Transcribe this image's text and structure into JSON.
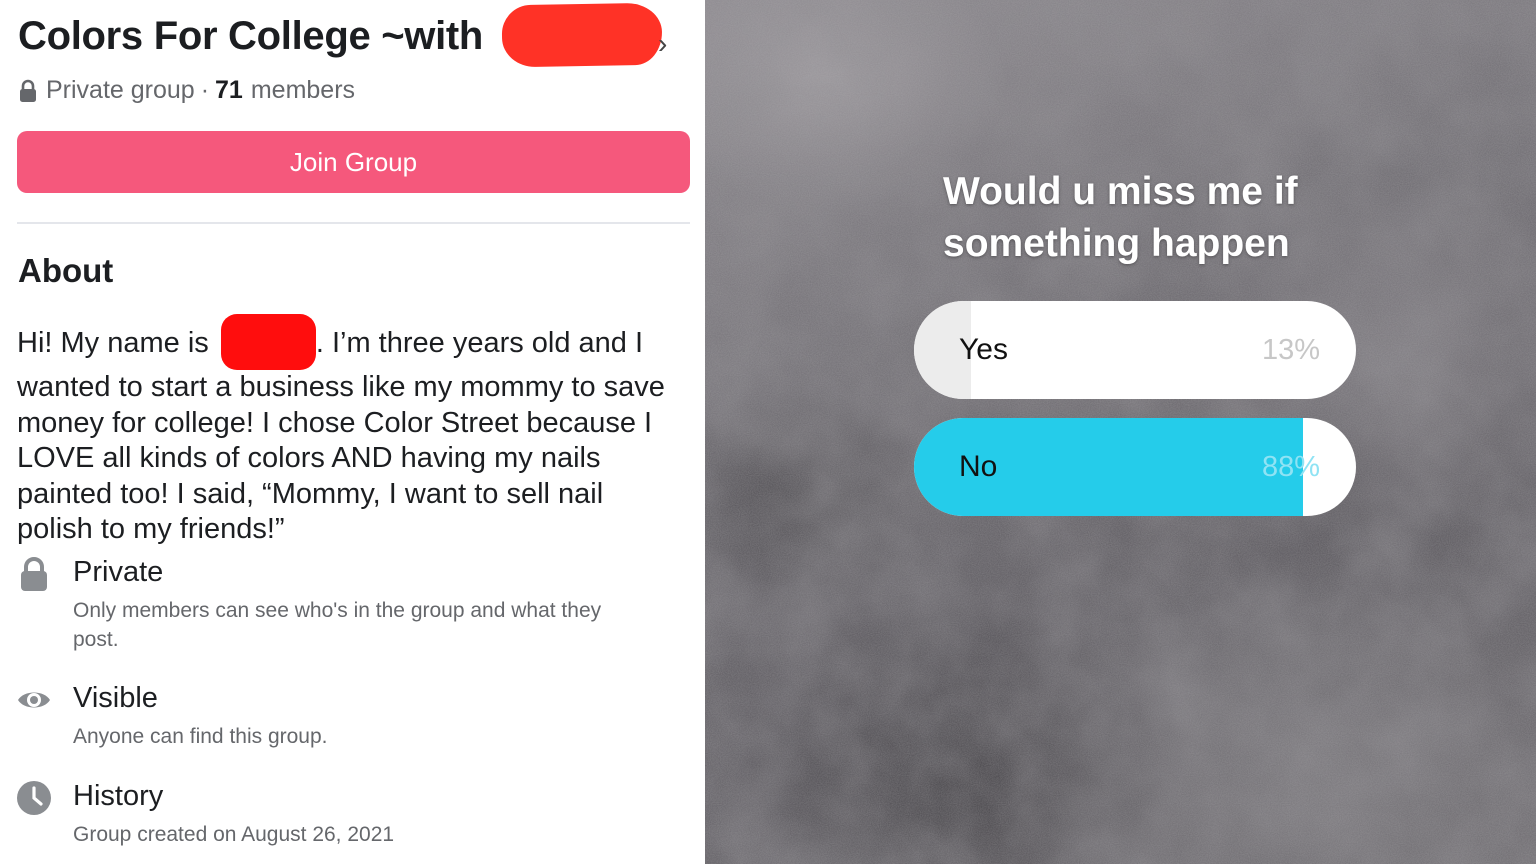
{
  "group": {
    "title": "Colors For College ~with",
    "privacy_label": "Private group",
    "separator": "·",
    "member_count": "71",
    "members_word": "members",
    "join_button_label": "Join Group"
  },
  "about": {
    "heading": "About",
    "lines": [
      "Hi! My name is",
      ". I’m three years old and I",
      "wanted to start a business like my mommy to save",
      "money for college! I chose Color Street because I",
      "LOVE all kinds of colors AND having my nails",
      "painted too! I said, “Mommy, I want to sell nail",
      "polish to my friends!”"
    ]
  },
  "info": {
    "private": {
      "title": "Private",
      "desc_line1": "Only members can see who's in the group and what they",
      "desc_line2": "post.",
      "icon": "lock-icon"
    },
    "visible": {
      "title": "Visible",
      "desc": "Anyone can find this group.",
      "icon": "eye-icon"
    },
    "history": {
      "title": "History",
      "desc": "Group created on August 26, 2021",
      "icon": "clock-icon"
    }
  },
  "poll": {
    "question_line1": "Would u miss me if",
    "question_line2": "something happen",
    "options": [
      {
        "label": "Yes",
        "percent_text": "13%",
        "fill_fraction": 0.13
      },
      {
        "label": "No",
        "percent_text": "88%",
        "fill_fraction": 0.88
      }
    ]
  },
  "colors": {
    "join_button": "#f5587c",
    "poll_accent": "#25ccea",
    "redaction": "#ff2a1f"
  }
}
